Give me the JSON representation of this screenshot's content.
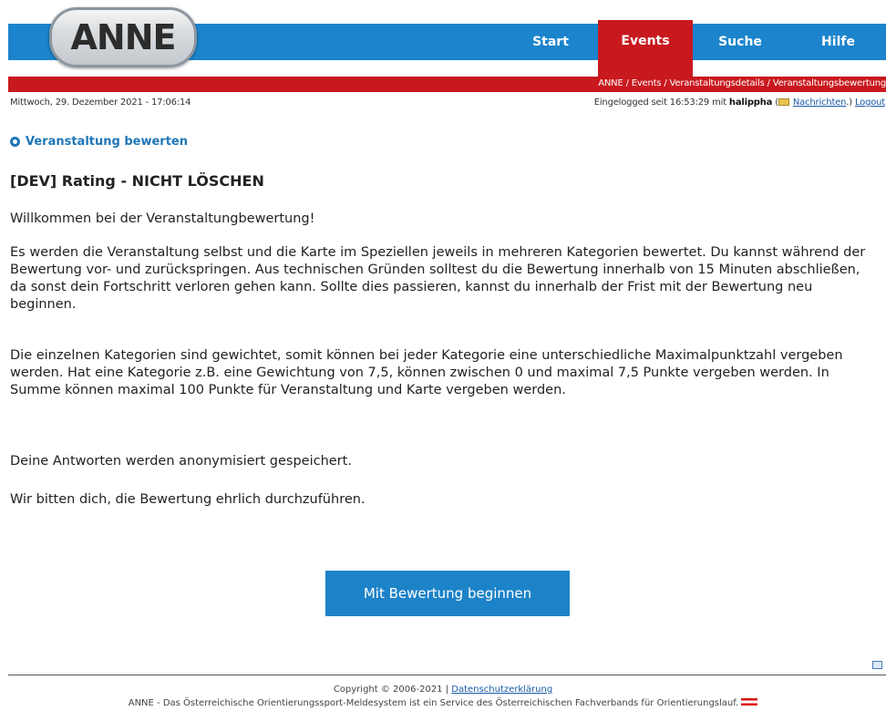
{
  "header": {
    "logo_text": "ANNE",
    "nav": {
      "start": "Start",
      "events": "Events",
      "suche": "Suche",
      "hilfe": "Hilfe"
    },
    "breadcrumb": "ANNE / Events / Veranstaltungsdetails / Veranstaltungsbewertung",
    "datetime": "Mittwoch, 29. Dezember 2021 - 17:06:14",
    "login": {
      "prefix": "Eingelogged seit 16:53:29 mit",
      "username": "halippha",
      "messages_open": "(",
      "messages_link": "Nachrichten",
      "messages_close": ".)",
      "logout": "Logout"
    }
  },
  "main": {
    "section_heading": "Veranstaltung bewerten",
    "event_title": "[DEV] Rating - NICHT LÖSCHEN",
    "paragraphs": [
      "Willkommen bei der Veranstaltungbewertung!",
      "Es werden die Veranstaltung selbst und die Karte im Speziellen jeweils in mehreren Kategorien bewertet. Du kannst während der Bewertung vor- und zurückspringen. Aus technischen Gründen solltest du die Bewertung innerhalb von 15 Minuten abschließen, da sonst dein Fortschritt verloren gehen kann. Sollte dies passieren, kannst du innerhalb der Frist mit der Bewertung neu beginnen.",
      "Die einzelnen Kategorien sind gewichtet, somit können bei jeder Kategorie eine unterschiedliche Maximalpunktzahl vergeben werden. Hat eine Kategorie z.B. eine Gewichtung von 7,5, können zwischen 0 und maximal 7,5 Punkte vergeben werden. In Summe können maximal 100 Punkte für Veranstaltung und Karte vergeben werden.",
      "Deine Antworten werden anonymisiert gespeichert.",
      "Wir bitten dich, die Bewertung ehrlich durchzuführen."
    ],
    "start_button": "Mit Bewertung beginnen"
  },
  "footer": {
    "copyright": "Copyright © 2006-2021 |",
    "privacy_link": "Datenschutzerklärung",
    "service_text": "ANNE - Das Österreichische Orientierungssport-Meldesystem ist ein Service des Österreichischen Fachverbands für Orientierungslauf."
  },
  "colors": {
    "nav_blue": "#1b84cc",
    "accent_red": "#c8191e",
    "heading_blue": "#1f76b8",
    "button_blue": "#1d83c8"
  },
  "icons": [
    "mail-icon",
    "circle-icon",
    "print-icon",
    "flag-icon"
  ]
}
